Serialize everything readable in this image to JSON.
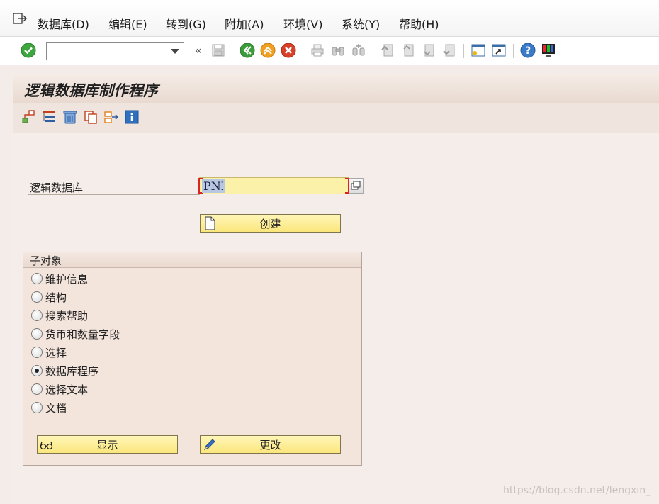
{
  "menubar": {
    "items": [
      "数据库(D)",
      "编辑(E)",
      "转到(G)",
      "附加(A)",
      "环境(V)",
      "系统(Y)",
      "帮助(H)"
    ]
  },
  "toolbar": {
    "command_value": ""
  },
  "screen": {
    "title": "逻辑数据库制作程序"
  },
  "form": {
    "ldb_label": "逻辑数据库",
    "ldb_value": "PNP",
    "create_label": "创建"
  },
  "subobjects": {
    "title": "子对象",
    "options": [
      "维护信息",
      "结构",
      "搜索帮助",
      "货币和数量字段",
      "选择",
      "数据库程序",
      "选择文本",
      "文档"
    ],
    "selected_index": 5,
    "display_label": "显示",
    "change_label": "更改"
  },
  "watermark": "https://blog.csdn.net/lengxin_",
  "colors": {
    "button_yellow": "#fbe67c",
    "input_yellow": "#fbf1a8",
    "background": "#f3ece8",
    "title_bar": "#e8d9cf"
  }
}
